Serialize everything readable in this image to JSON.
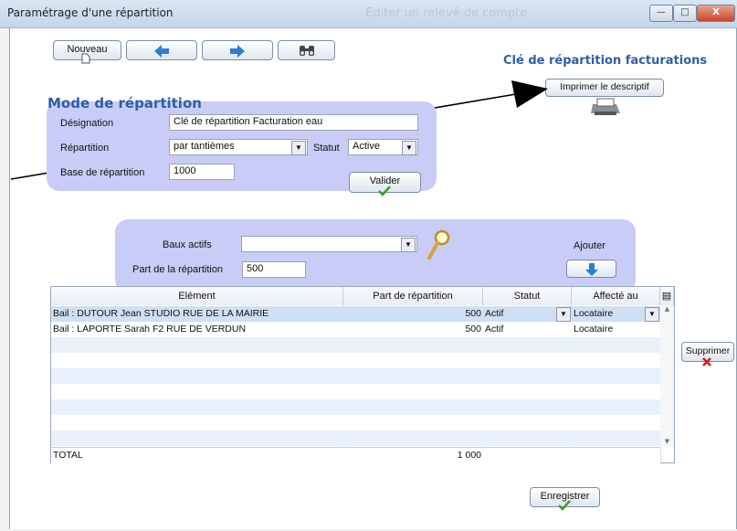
{
  "window": {
    "title": "Paramétrage d'une répartition",
    "ghost_title": "Editer un relevé de compte",
    "minimize": "—",
    "maximize": "□",
    "close": "X"
  },
  "toolbar": {
    "new_label": "Nouveau",
    "prev_icon": "left-arrow-icon",
    "next_icon": "right-arrow-icon",
    "search_icon": "binoculars-icon"
  },
  "header": {
    "title": "Clé de répartition facturations",
    "print_label": "Imprimer le descriptif"
  },
  "mode": {
    "heading": "Mode de répartition",
    "designation_label": "Désignation",
    "designation_value": "Clé de répartition Facturation eau",
    "repartition_label": "Répartition",
    "repartition_value": "par tantièmes",
    "statut_label": "Statut",
    "statut_value": "Active",
    "base_label": "Base de répartition",
    "base_value": "1000",
    "validate_label": "Valider"
  },
  "baux": {
    "baux_label": "Baux actifs",
    "baux_value": "",
    "part_label": "Part de la répartition",
    "part_value": "500",
    "add_label": "Ajouter"
  },
  "table": {
    "columns": [
      "Elément",
      "Part de répartition",
      "Statut",
      "Affecté au"
    ],
    "rows": [
      {
        "element": "Bail : DUTOUR Jean STUDIO RUE DE LA MAIRIE",
        "part": "500",
        "statut": "Actif",
        "affecte": "Locataire"
      },
      {
        "element": "Bail : LAPORTE Sarah F2 RUE DE VERDUN",
        "part": "500",
        "statut": "Actif",
        "affecte": "Locataire"
      }
    ],
    "total_label": "TOTAL",
    "total_value": "1 000"
  },
  "actions": {
    "delete_label": "Supprimer",
    "save_label": "Enregistrer"
  },
  "colors": {
    "panel": "#c9ccf6",
    "heading": "#2f5ea8",
    "arrow": "#2a7fd4",
    "check": "#3aa12b",
    "delete_x": "#d11c1c"
  }
}
